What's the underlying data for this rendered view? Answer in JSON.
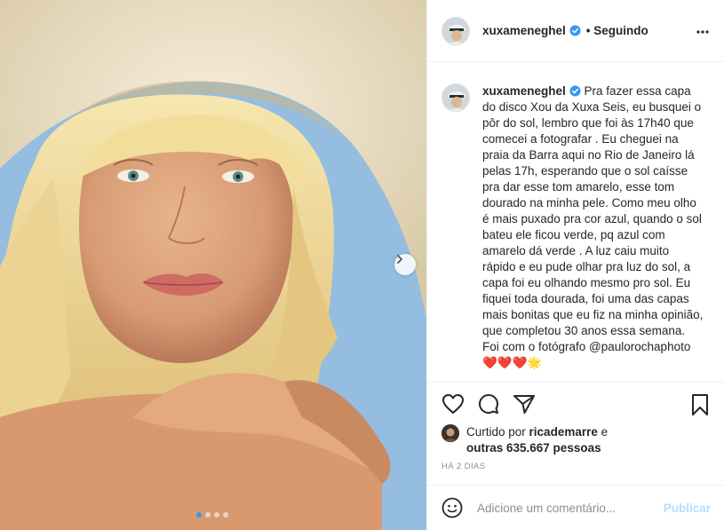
{
  "post": {
    "username": "xuxameneghel",
    "follow_status": "• Seguindo",
    "caption_username": "xuxameneghel",
    "caption_text": " Pra fazer essa capa do disco Xou da Xuxa Seis, eu busquei o pôr do sol, lembro que foi às 17h40 que comecei a fotografar . Eu cheguei na praia da Barra aqui no Rio de Janeiro lá pelas 17h, esperando que o sol caísse pra dar esse tom amarelo, esse tom dourado na minha pele. Como meu olho é mais puxado pra cor azul, quando o sol bateu ele ficou verde, pq azul com amarelo dá verde . A luz caiu muito rápido e eu pude olhar pra luz do sol, a capa foi eu olhando mesmo pro sol. Eu fiquei toda dourada, foi uma das capas mais bonitas que eu fiz na minha opinião, que completou 30 anos essa semana. Foi com o fotógrafo @paulorochaphoto ❤️❤️❤️🌟",
    "carousel": {
      "slides": 4,
      "active_index": 0
    }
  },
  "likes": {
    "prefix": "Curtido por ",
    "user": "ricademarre",
    "middle": " e ",
    "others": "outras 635.667 pessoas"
  },
  "timestamp": "HÁ 2 DIAS",
  "comment": {
    "placeholder": "Adicione um comentário...",
    "publish_label": "Publicar"
  },
  "colors": {
    "verified": "#3897f0",
    "publish_disabled": "#b2dffc",
    "divider": "#efefef",
    "hat": "#efe3c4",
    "sky": "#8fb8dc"
  },
  "icons": [
    "verified-badge-icon",
    "more-options-icon",
    "next-arrow-icon",
    "heart-icon",
    "comment-icon",
    "share-icon",
    "bookmark-icon",
    "emoji-icon"
  ]
}
